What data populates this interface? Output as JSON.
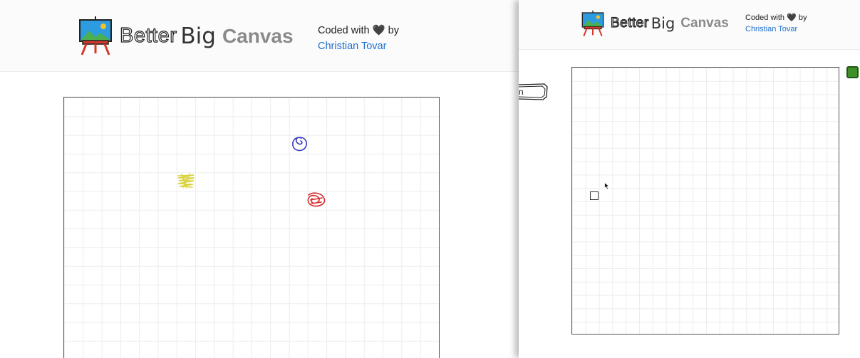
{
  "brand": {
    "word_better": "Better",
    "word_big": "Big",
    "word_canvas": "Canvas"
  },
  "credit": {
    "prefix": "Coded with",
    "heart": "🖤",
    "suffix": "by",
    "author": "Christian Tovar"
  },
  "left_window": {
    "strokes": [
      {
        "name": "blue-spiral-scribble",
        "color": "#3a3ac2"
      },
      {
        "name": "yellow-scribble",
        "color": "#d8d23a"
      },
      {
        "name": "red-scribble",
        "color": "#d62828"
      }
    ]
  },
  "right_window": {
    "side_tab_label": "n",
    "selected_color": "#3f8f2a"
  },
  "icons": {
    "easel": "easel-painting-icon",
    "swatch": "color-swatch",
    "cursor": "arrow-cursor-icon"
  }
}
